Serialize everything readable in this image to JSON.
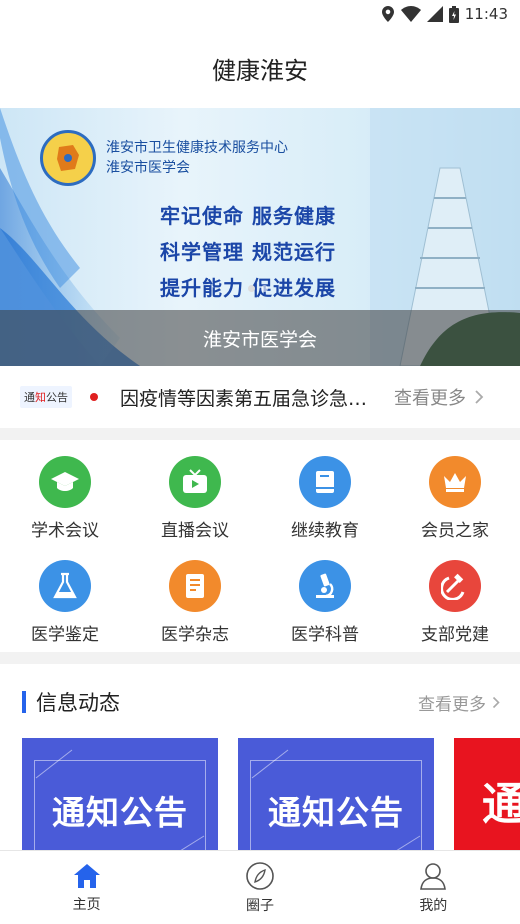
{
  "status_bar": {
    "time": "11:43"
  },
  "header": {
    "title": "健康淮安"
  },
  "banner": {
    "org_lines": [
      "淮安市卫生健康技术服务中心",
      "淮安市医学会"
    ],
    "slogan_lines": [
      "牢记使命  服务健康",
      "科学管理  规范运行",
      "提升能力  促进发展"
    ],
    "caption": "淮安市医学会",
    "pages": 2,
    "active_page": 1
  },
  "notice": {
    "tag_prefix": "通",
    "tag_highlight": "知",
    "tag_suffix": "公告",
    "text": "因疫情等因素第五届急诊急救大会延期举办通知",
    "more": "查看更多"
  },
  "grid": [
    {
      "label": "学术会议",
      "icon": "graduation-cap-icon",
      "color": "#39b54a"
    },
    {
      "label": "直播会议",
      "icon": "tv-icon",
      "color": "#39b54a"
    },
    {
      "label": "继续教育",
      "icon": "book-icon",
      "color": "#2f8de4"
    },
    {
      "label": "会员之家",
      "icon": "crown-icon",
      "color": "#f0882a"
    },
    {
      "label": "医学鉴定",
      "icon": "flask-icon",
      "color": "#2f8de4"
    },
    {
      "label": "医学杂志",
      "icon": "magazine-icon",
      "color": "#f0882a"
    },
    {
      "label": "医学科普",
      "icon": "microscope-icon",
      "color": "#2f8de4"
    },
    {
      "label": "支部党建",
      "icon": "hammer-sickle-icon",
      "color": "#e8403a"
    }
  ],
  "info": {
    "title": "信息动态",
    "more": "查看更多",
    "cards": [
      {
        "text": "通知公告",
        "color": "#4a5bd8"
      },
      {
        "text": "通知公告",
        "color": "#4a5bd8"
      },
      {
        "text": "通",
        "color": "#e8141f"
      }
    ]
  },
  "tabs": [
    {
      "label": "主页",
      "icon": "home-icon",
      "active": true,
      "color": "#2563eb"
    },
    {
      "label": "圈子",
      "icon": "compass-icon",
      "active": false
    },
    {
      "label": "我的",
      "icon": "user-icon",
      "active": false
    }
  ]
}
